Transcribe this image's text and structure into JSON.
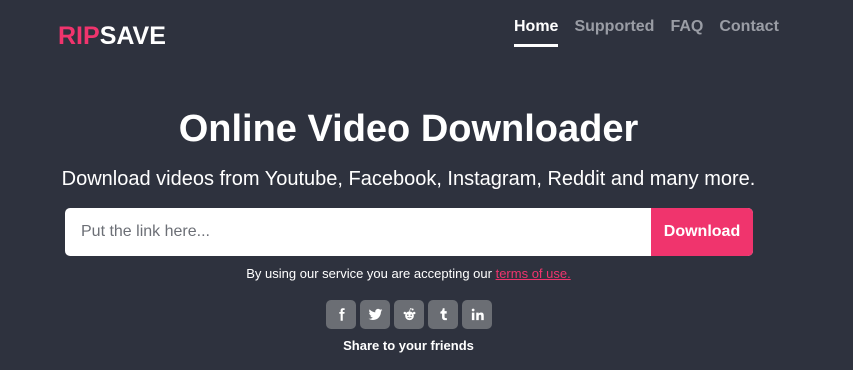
{
  "logo": {
    "part1": "RIP",
    "part2": "SAVE"
  },
  "nav": {
    "items": [
      {
        "label": "Home"
      },
      {
        "label": "Supported"
      },
      {
        "label": "FAQ"
      },
      {
        "label": "Contact"
      }
    ],
    "active": "Home"
  },
  "hero": {
    "title": "Online Video Downloader",
    "subtitle": "Download videos from Youtube, Facebook, Instagram, Reddit and many more."
  },
  "search": {
    "placeholder": "Put the link here...",
    "value": "",
    "button_label": "Download"
  },
  "terms": {
    "text": "By using our service you are accepting our ",
    "link_label": "terms of use."
  },
  "share": {
    "buttons": [
      {
        "icon": "facebook-icon"
      },
      {
        "icon": "twitter-icon"
      },
      {
        "icon": "reddit-icon"
      },
      {
        "icon": "tumblr-icon"
      },
      {
        "icon": "linkedin-icon"
      }
    ],
    "label": "Share to your friends"
  },
  "colors": {
    "background": "#2e323e",
    "accent": "#f0346d",
    "nav_inactive": "#9a9da5",
    "social_button": "#6b6e74"
  }
}
